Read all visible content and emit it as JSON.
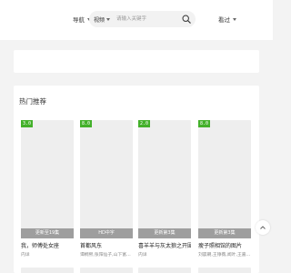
{
  "header": {
    "nav_label": "导航",
    "search": {
      "category": "视频",
      "placeholder": "请输入关键字"
    },
    "history_label": "看过"
  },
  "hot": {
    "title": "热门推荐",
    "cards": [
      {
        "score": "3.0",
        "status": "更新至19集",
        "title": "我，师傅处女座",
        "sub": "内详"
      },
      {
        "score": "8.0",
        "status": "HD中字",
        "title": "首都风东",
        "sub": "谭桐熙,张阳仙子,山下富…"
      },
      {
        "score": "2.0",
        "status": "更新第3集",
        "title": "喜羊羊与灰太狼之开围…",
        "sub": "内详"
      },
      {
        "score": "8.0",
        "status": "更新第3集",
        "title": "瘦子照相馆的图片",
        "sub": "刘晨朝,王铮薇,闻叶,王嘉…"
      }
    ]
  },
  "colors": {
    "score_badge": "#43b02a",
    "background": "#f3f3f3"
  }
}
